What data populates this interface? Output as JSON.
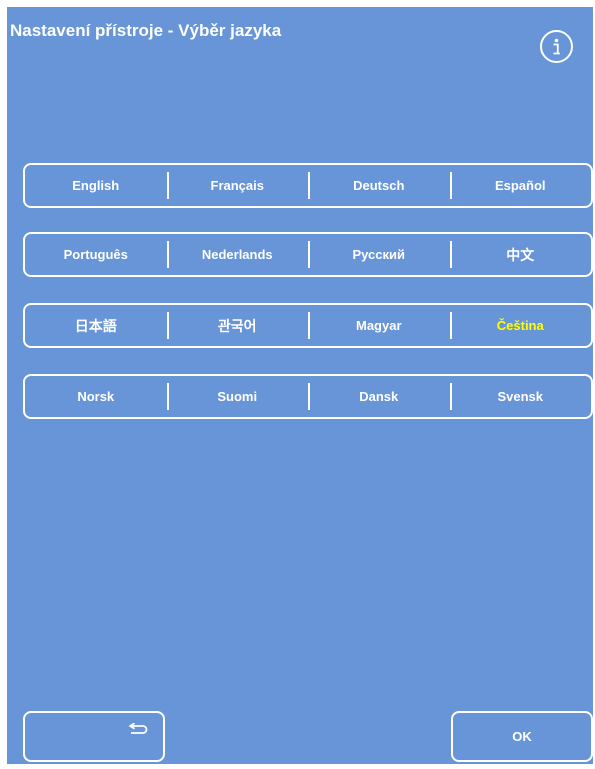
{
  "header": {
    "title": "Nastavení přístroje - Výběr jazyka",
    "info_icon": "info-icon"
  },
  "languages": {
    "rows": [
      [
        "English",
        "Français",
        "Deutsch",
        "Español"
      ],
      [
        "Português",
        "Nederlands",
        "Русский",
        "中文"
      ],
      [
        "日本語",
        "관국어",
        "Magyar",
        "Čeština"
      ],
      [
        "Norsk",
        "Suomi",
        "Dansk",
        "Svensk"
      ]
    ],
    "selected": "Čeština"
  },
  "footer": {
    "back_icon": "return-arrow-icon",
    "ok_label": "OK"
  },
  "colors": {
    "background": "#6795d8",
    "border": "#ffffff",
    "text": "#ffffff",
    "selected_text": "#ffff00"
  }
}
